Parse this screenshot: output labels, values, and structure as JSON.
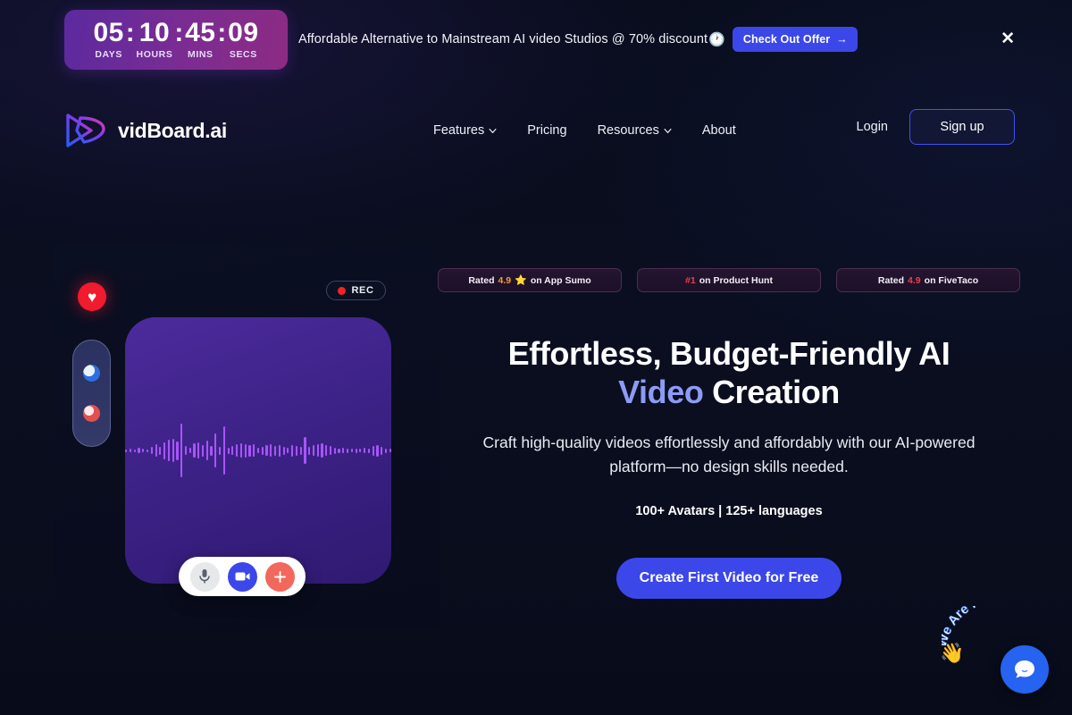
{
  "promo": {
    "countdown": {
      "days": {
        "value": "05",
        "label": "DAYS"
      },
      "hours": {
        "value": "10",
        "label": "HOURS"
      },
      "mins": {
        "value": "45",
        "label": "MINS"
      },
      "secs": {
        "value": "09",
        "label": "SECS"
      },
      "separator": ":"
    },
    "message": "Affordable Alternative to Mainstream AI video Studios @ 70% discount",
    "clock_emoji": "🕐",
    "cta_label": "Check Out Offer",
    "cta_arrow": "→",
    "close_label": "✕",
    "accent_color": "#3b47e8",
    "banner_gradient_from": "#5b2a9e",
    "banner_gradient_to": "#8d2b83"
  },
  "nav": {
    "brand": "vidBoard.ai",
    "links": [
      {
        "label": "Features",
        "has_dropdown": true
      },
      {
        "label": "Pricing",
        "has_dropdown": false
      },
      {
        "label": "Resources",
        "has_dropdown": true
      },
      {
        "label": "About",
        "has_dropdown": false
      }
    ],
    "login_label": "Login",
    "signup_label": "Sign up",
    "signup_border_color": "#4550f0"
  },
  "demo": {
    "rec_label": "REC",
    "rec_dot_color": "#f52222",
    "heart_icon": "♥",
    "heart_bg_color": "#f01b2e",
    "card_gradient_from": "#4c2b9c",
    "card_gradient_to": "#2f1a72",
    "waveform_color": "#a855f7",
    "waveform_heights": [
      3,
      4,
      3,
      6,
      4,
      3,
      8,
      14,
      9,
      19,
      24,
      26,
      21,
      60,
      10,
      6,
      16,
      18,
      13,
      22,
      11,
      38,
      9,
      54,
      7,
      10,
      14,
      16,
      15,
      13,
      14,
      6,
      9,
      12,
      14,
      11,
      13,
      9,
      6,
      13,
      11,
      9,
      30,
      9,
      12,
      14,
      16,
      12,
      10,
      7,
      5,
      6,
      5,
      4,
      5,
      4,
      6,
      5,
      11,
      13,
      9,
      5,
      4
    ],
    "controls": [
      {
        "name": "microphone",
        "icon": "mic",
        "bg": "#e7e8ea"
      },
      {
        "name": "camera",
        "icon": "cam",
        "bg": "#3b47e8"
      },
      {
        "name": "add",
        "icon": "plus",
        "bg": "#f2685c"
      }
    ]
  },
  "hero": {
    "badges": [
      {
        "prefix": "Rated ",
        "value": "4.9",
        "value_color": "gold",
        "star": "⭐",
        "suffix": " on App Sumo"
      },
      {
        "prefix": "",
        "value": "#1",
        "value_color": "red",
        "star": "",
        "suffix": " on Product Hunt"
      },
      {
        "prefix": "Rated ",
        "value": "4.9",
        "value_color": "red",
        "star": "",
        "suffix": " on FiveTaco"
      }
    ],
    "headline_line1": "Effortless, Budget-Friendly AI",
    "headline_accent": "Video",
    "headline_line2_rest": " Creation",
    "headline_accent_color": "#8e9bf4",
    "subheadline": "Craft high-quality videos effortlessly and affordably with our AI-powered platform—no design skills needed.",
    "stats": "100+ Avatars | 125+ languages",
    "cta_label": "Create First Video for Free",
    "cta_color": "#3b47e8"
  },
  "chat": {
    "bubble_text": "We Are Here!",
    "wave_emoji": "👋",
    "button_color": "#2563f0",
    "icon_name": "chat-bubble-icon"
  }
}
